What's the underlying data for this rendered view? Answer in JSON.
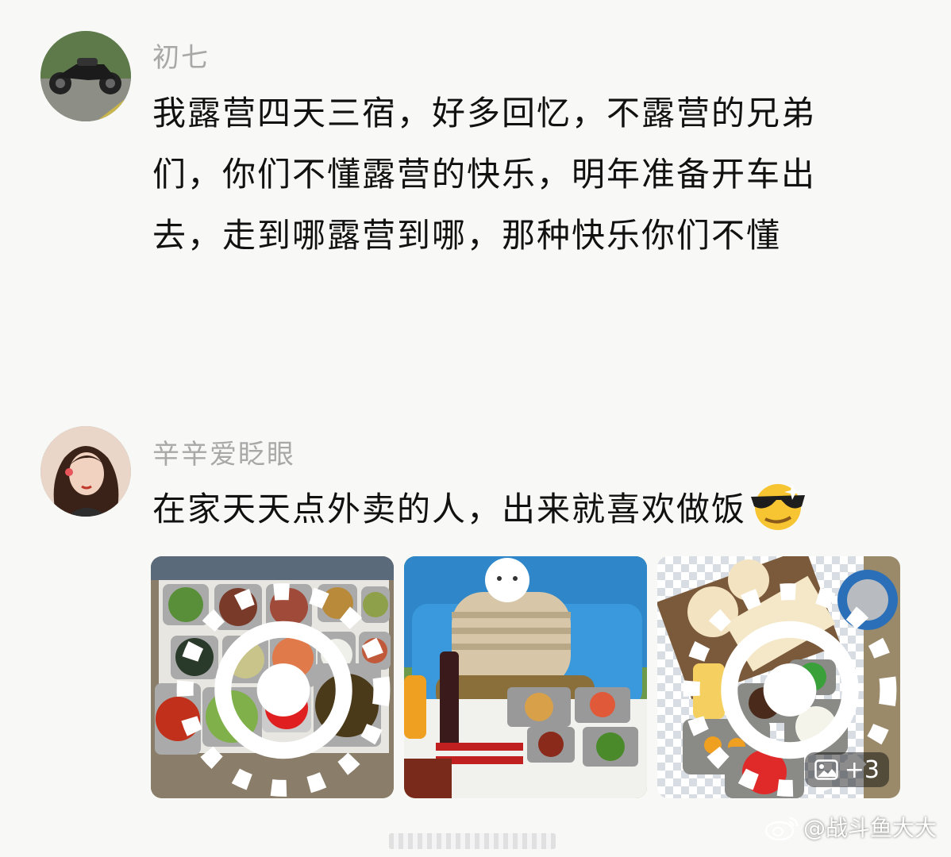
{
  "comments": [
    {
      "username": "初七",
      "lines": [
        "我露营四天三宿，好多回忆，不露营的兄弟",
        "们，你们不懂露营的快乐，明年准备开车出",
        "去，走到哪露营到哪，那种快乐你们不懂"
      ]
    },
    {
      "username": "辛辛爱眨眼",
      "text": "在家天天点外卖的人，出来就喜欢做饭",
      "emoji": "sunglasses-grin-emoji",
      "images": [
        {
          "name": "bbq-food-spread-photo",
          "icon": "live-photo-icon"
        },
        {
          "name": "man-with-picnic-food-photo"
        },
        {
          "name": "cooking-ingredients-photo",
          "icon": "live-photo-icon"
        }
      ],
      "more_count": "+3"
    }
  ],
  "watermark": "@战斗鱼大大",
  "colors": {
    "background": "#f8f8f6",
    "username": "#a8a8a8",
    "text": "#111111"
  }
}
